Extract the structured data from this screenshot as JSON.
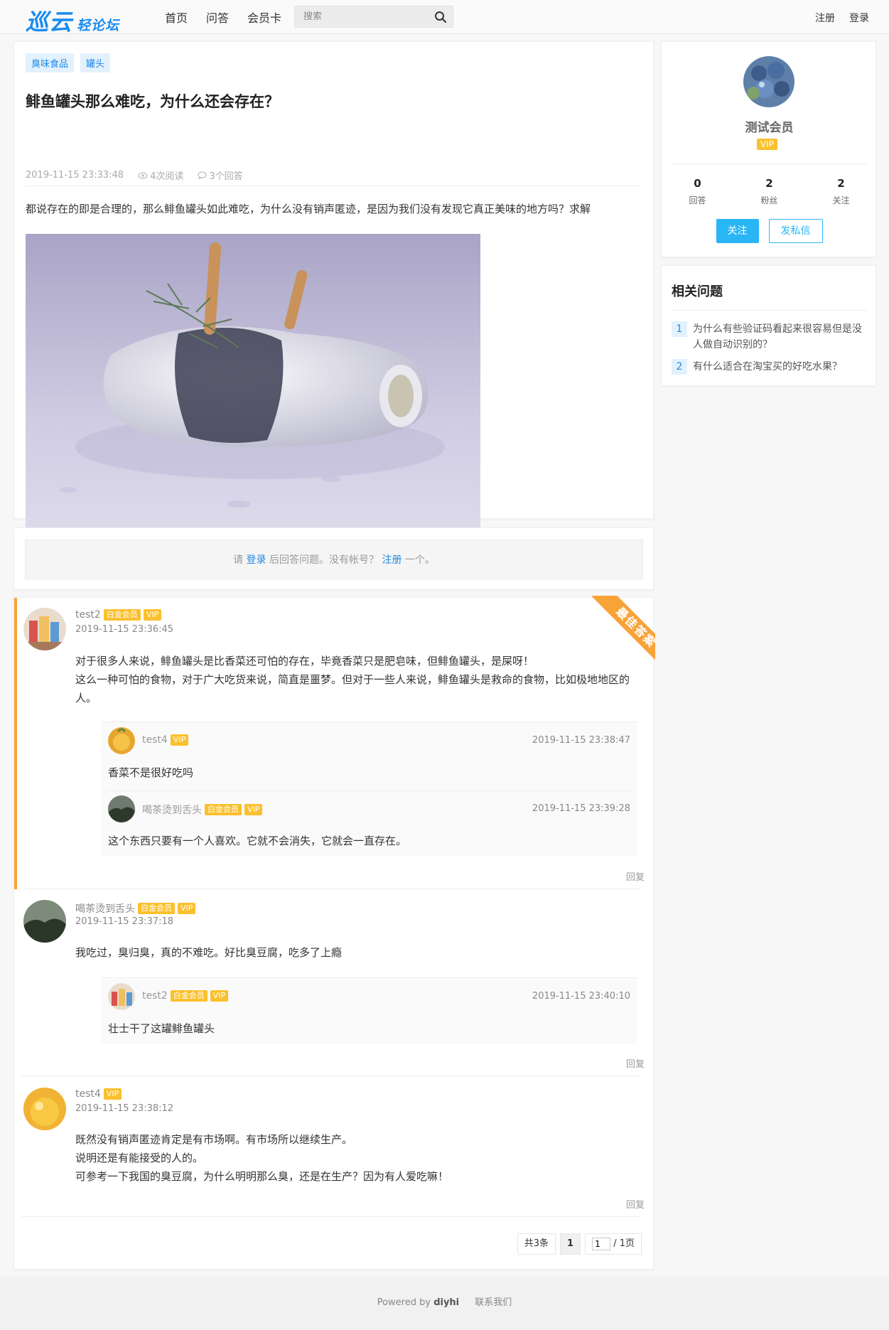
{
  "header": {
    "logo_big": "巡云",
    "logo_small": "轻论坛",
    "nav": [
      "首页",
      "问答",
      "会员卡"
    ],
    "search_placeholder": "搜索",
    "register": "注册",
    "login": "登录"
  },
  "question": {
    "tags": [
      "臭味食品",
      "罐头"
    ],
    "title": "鲱鱼罐头那么难吃，为什么还会存在？",
    "time": "2019-11-15 23:33:48",
    "views": "4次阅读",
    "answers_count": "3个回答",
    "body": "都说存在的即是合理的，那么鲱鱼罐头如此难吃，为什么没有销声匿迹，是因为我们没有发现它真正美味的地方吗？求解"
  },
  "login_prompt": {
    "pre": "请 ",
    "login": "登录",
    "mid": " 后回答问题。没有帐号？ ",
    "register": "注册",
    "post": " 一个。"
  },
  "best_label": "最佳答案",
  "reply_label": "回复",
  "answers": [
    {
      "user": "test2",
      "badges": [
        "白金会员",
        "VIP"
      ],
      "time": "2019-11-15 23:36:45",
      "lines": [
        "对于很多人来说，鲱鱼罐头是比香菜还可怕的存在，毕竟香菜只是肥皂味，但鲱鱼罐头，是屎呀！",
        "这么一种可怕的食物，对于广大吃货来说，简直是噩梦。但对于一些人来说，鲱鱼罐头是救命的食物，比如极地地区的",
        "人。"
      ],
      "replies": [
        {
          "user": "test4",
          "badges": [
            "VIP"
          ],
          "time": "2019-11-15 23:38:47",
          "text": "香菜不是很好吃吗"
        },
        {
          "user": "喝茶烫到舌头",
          "badges": [
            "白金会员",
            "VIP"
          ],
          "time": "2019-11-15 23:39:28",
          "text": "这个东西只要有一个人喜欢。它就不会消失，它就会一直存在。"
        }
      ]
    },
    {
      "user": "喝茶烫到舌头",
      "badges": [
        "白金会员",
        "VIP"
      ],
      "time": "2019-11-15 23:37:18",
      "lines": [
        "我吃过，臭归臭，真的不难吃。好比臭豆腐，吃多了上瘾"
      ],
      "replies": [
        {
          "user": "test2",
          "badges": [
            "白金会员",
            "VIP"
          ],
          "time": "2019-11-15 23:40:10",
          "text": "壮士干了这罐鲱鱼罐头"
        }
      ]
    },
    {
      "user": "test4",
      "badges": [
        "VIP"
      ],
      "time": "2019-11-15 23:38:12",
      "lines": [
        "既然没有销声匿迹肯定是有市场啊。有市场所以继续生产。",
        "说明还是有能接受的人的。",
        "可参考一下我国的臭豆腐，为什么明明那么臭，还是在生产？因为有人爱吃嘛！"
      ],
      "replies": []
    }
  ],
  "pager": {
    "total": "共3条",
    "current": "1",
    "input_value": "1",
    "pages": "/ 1页"
  },
  "user_card": {
    "name": "测试会员",
    "vip": "VIP",
    "stats": [
      {
        "num": "0",
        "label": "回答"
      },
      {
        "num": "2",
        "label": "粉丝"
      },
      {
        "num": "2",
        "label": "关注"
      }
    ],
    "follow": "关注",
    "message": "发私信"
  },
  "related": {
    "title": "相关问题",
    "items": [
      {
        "num": "1",
        "text": "为什么有些验证码看起来很容易但是没人做自动识别的？"
      },
      {
        "num": "2",
        "text": "有什么适合在淘宝买的好吃水果？"
      }
    ]
  },
  "footer": {
    "powered": "Powered by",
    "brand": "diyhi",
    "contact": "联系我们"
  },
  "colors": {
    "brand": "#1a8cf0",
    "accent": "#29b6f6",
    "best": "#f7a338",
    "badge": "#fbc02d"
  }
}
